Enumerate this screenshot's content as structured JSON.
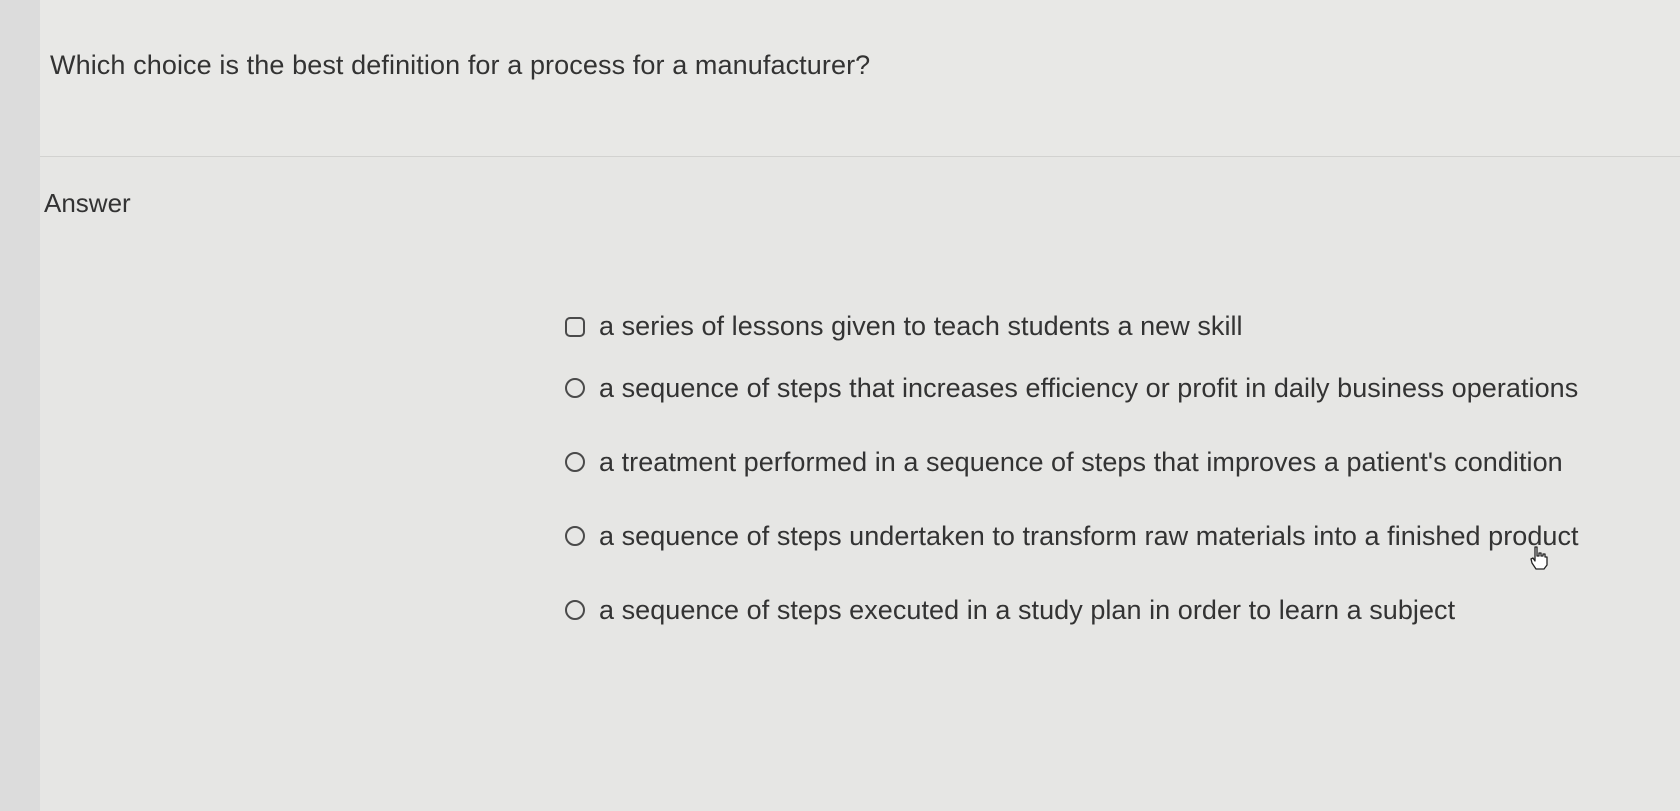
{
  "question": {
    "text": "Which choice is the best definition for a process for a manufacturer?"
  },
  "answer": {
    "label": "Answer",
    "options": [
      {
        "label": "a series of lessons given to teach students a new skill"
      },
      {
        "label": "a sequence of steps that increases efficiency or profit in daily business operations"
      },
      {
        "label": "a treatment performed in a sequence of steps that improves a patient's condition"
      },
      {
        "label": "a sequence of steps undertaken to transform raw materials into a finished product"
      },
      {
        "label": "a sequence of steps executed in a study plan in order to learn a subject"
      }
    ]
  },
  "icons": {
    "cursor": "hand-pointer-icon",
    "radio": "radio-button-icon"
  }
}
